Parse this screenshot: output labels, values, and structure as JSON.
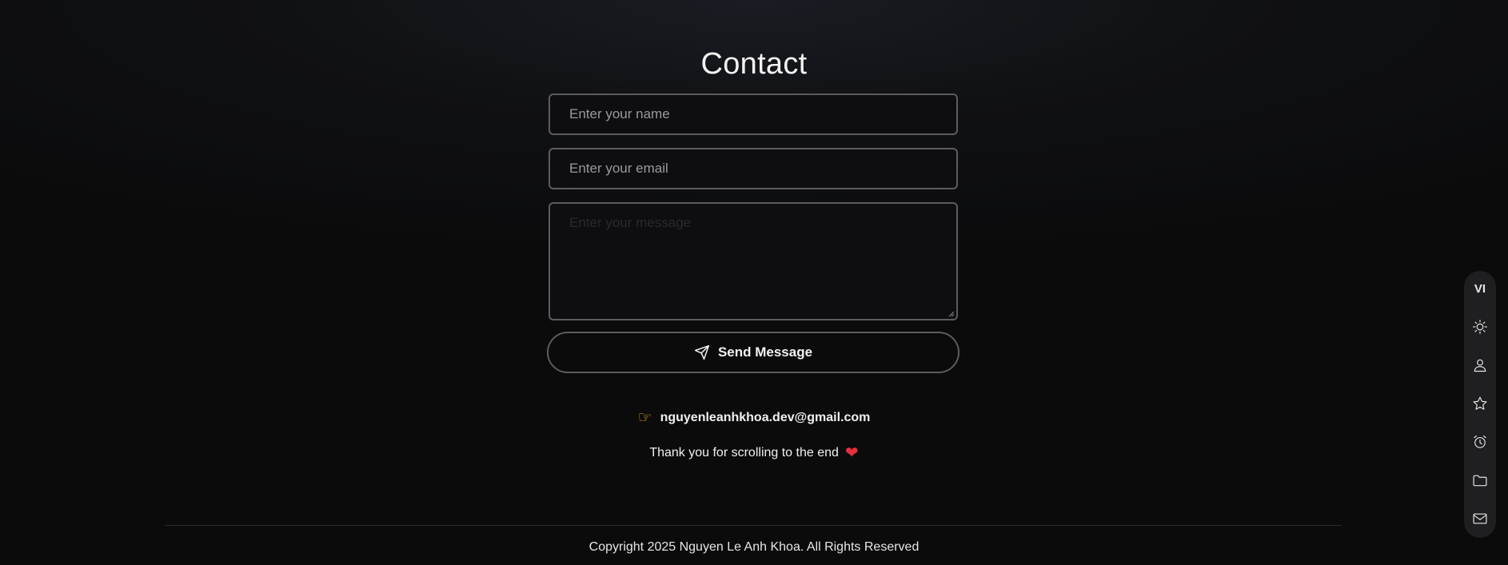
{
  "contact": {
    "title": "Contact",
    "name_placeholder": "Enter your name",
    "email_placeholder": "Enter your email",
    "message_placeholder": "Enter your message",
    "send_label": "Send Message",
    "email": "nguyenleanhkhoa.dev@gmail.com",
    "hand_emoji": "☞",
    "thanks": "Thank you for scrolling to the end",
    "heart": "❤"
  },
  "footer": {
    "copyright": "Copyright 2025 Nguyen Le Anh Khoa. All Rights Reserved"
  },
  "side_rail": {
    "language": "VI",
    "icons": [
      "sun-icon",
      "user-icon",
      "star-icon",
      "alarm-clock-icon",
      "folder-icon",
      "mail-icon"
    ]
  },
  "colors": {
    "background": "#0b0b0c",
    "border": "#5c5c60",
    "hand": "#e8a317",
    "heart": "#e5313d",
    "rail": "#1f1f21"
  }
}
